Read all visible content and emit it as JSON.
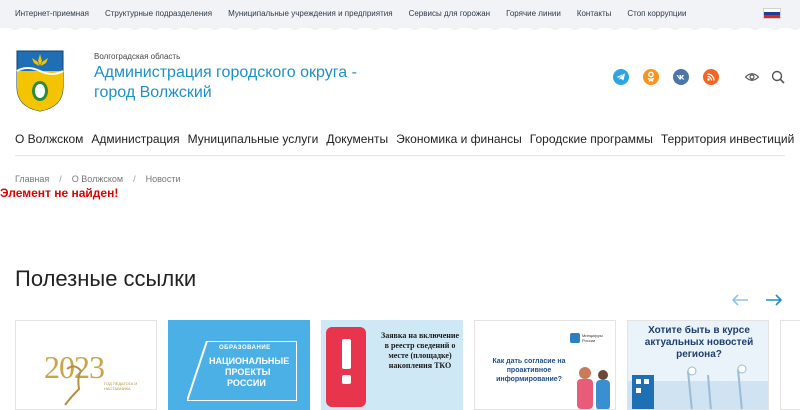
{
  "topbar": {
    "links": [
      "Интернет-приемная",
      "Структурные подразделения",
      "Муниципальные учреждения и предприятия",
      "Сервисы для горожан",
      "Горячие линии",
      "Контакты",
      "Стоп коррупции"
    ]
  },
  "header": {
    "region": "Волгоградская область",
    "title": "Администрация городского округа - город Волжский"
  },
  "nav": {
    "items": [
      "О Волжском",
      "Администрация",
      "Муниципальные услуги",
      "Документы",
      "Экономика и финансы",
      "Городские программы",
      "Территория инвестиций"
    ]
  },
  "breadcrumbs": [
    "Главная",
    "О Волжском",
    "Новости"
  ],
  "error_text": "Элемент не найден!",
  "useful_links": {
    "title": "Полезные ссылки",
    "cards": [
      {
        "year": "2023",
        "sub": "ГОД ПЕДАГОГА И НАСТАВНИКА"
      },
      {
        "line1": "ОБРАЗОВАНИЕ",
        "line2": "НАЦИОНАЛЬНЫЕ",
        "line3": "ПРОЕКТЫ",
        "line4": "РОССИИ"
      },
      {
        "text": "Заявка на включение в реестр сведений о месте (площадке) накопления ТКО"
      },
      {
        "text": "Как дать согласие на проактивное информирование?",
        "brand": "Минцифры России"
      },
      {
        "text": "Хотите быть в курсе актуальных новостей региона?"
      }
    ]
  },
  "colors": {
    "accent": "#1f8fc7",
    "error": "#e00000",
    "telegram": "#2ca5e0",
    "ok": "#f7931e",
    "vk": "#4a76a8",
    "rss": "#f26522"
  }
}
